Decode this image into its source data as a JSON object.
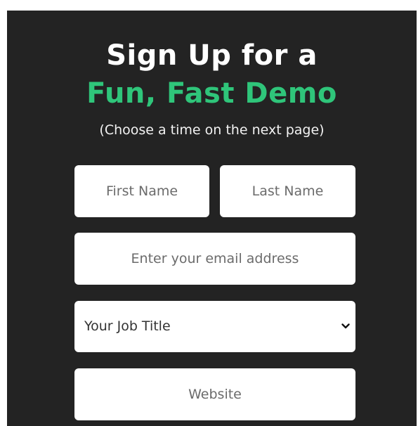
{
  "header": {
    "title_line1": "Sign Up for a",
    "title_line2": "Fun, Fast Demo",
    "subtitle": "(Choose a time on the next page)"
  },
  "form": {
    "first_name": {
      "placeholder": "First Name",
      "value": ""
    },
    "last_name": {
      "placeholder": "Last Name",
      "value": ""
    },
    "email": {
      "placeholder": "Enter your email address",
      "value": ""
    },
    "job_title": {
      "selected": "Your Job Title",
      "icon": "chevron-down-icon"
    },
    "website": {
      "placeholder": "Website",
      "value": ""
    }
  },
  "colors": {
    "panel_background": "#232323",
    "accent": "#2fc57a",
    "field_background": "#ffffff"
  }
}
